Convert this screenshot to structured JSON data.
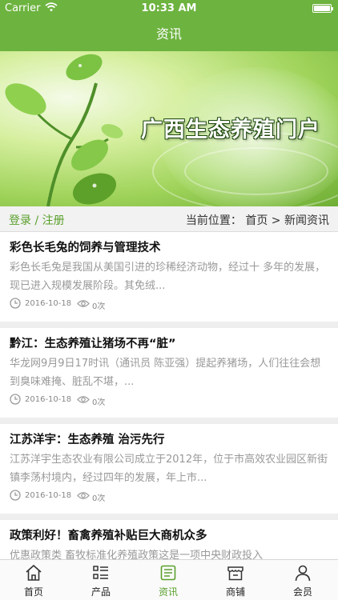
{
  "status_bar": {
    "carrier": "Carrier",
    "time": "10:33 AM"
  },
  "nav": {
    "title": "资讯"
  },
  "banner": {
    "title": "广西生态养殖门户"
  },
  "crumb": {
    "login": "登录 / 注册",
    "location": "当前位置：  首页 > 新闻资讯"
  },
  "news": [
    {
      "title": "彩色长毛兔的饲养与管理技术",
      "summary": "彩色长毛兔是我国从美国引进的珍稀经济动物，经过十 多年的发展，现已进入规模发展阶段。其免绒...",
      "date": "2016-10-18",
      "views": "0次"
    },
    {
      "title": "黔江：生态养殖让猪场不再“脏”",
      "summary": "  华龙网9月9日17时讯（通讯员 陈亚强）提起养猪场，人们往往会想到臭味难掩、脏乱不堪，...",
      "date": "2016-10-18",
      "views": "0次"
    },
    {
      "title": "江苏洋宇：生态养殖 治污先行",
      "summary": "江苏洋宇生态农业有限公司成立于2012年，位于市高效农业园区新街镇李荡村境内，经过四年的发展，年上市...",
      "date": "2016-10-18",
      "views": "0次"
    },
    {
      "title": "政策利好！畜禽养殖补贴巨大商机众多",
      "summary": "  优惠政策类    畜牧标准化养殖政策这是一项中央财政投入",
      "date": "",
      "views": ""
    }
  ],
  "tabs": [
    {
      "label": "首页",
      "icon": "home-icon"
    },
    {
      "label": "产品",
      "icon": "list-icon"
    },
    {
      "label": "资讯",
      "icon": "news-icon",
      "active": true
    },
    {
      "label": "商铺",
      "icon": "store-icon"
    },
    {
      "label": "会员",
      "icon": "user-icon"
    }
  ],
  "colors": {
    "brand_green": "#6db33f",
    "link_green": "#5aa02c"
  }
}
